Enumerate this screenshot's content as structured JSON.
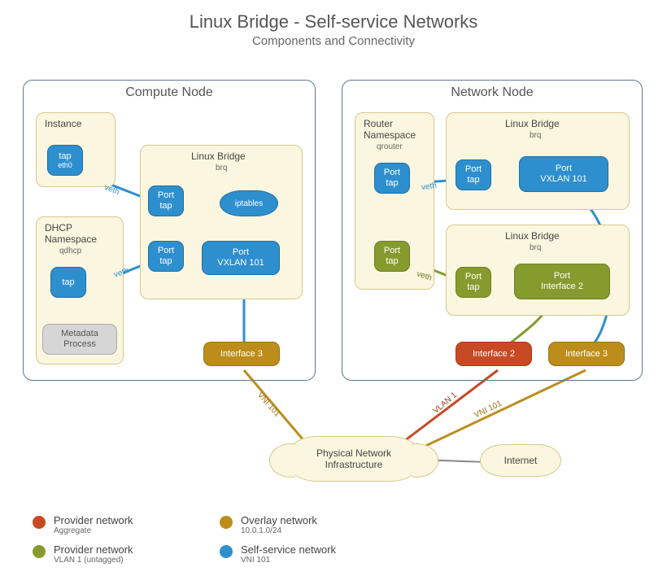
{
  "title": "Linux Bridge - Self-service Networks",
  "subtitle": "Components and Connectivity",
  "compute": {
    "title": "Compute Node",
    "instance": {
      "label": "Instance",
      "tap": "tap",
      "tap_sub": "eth0"
    },
    "dhcp": {
      "label": "DHCP",
      "label2": "Namespace",
      "sub": "qdhcp",
      "tap": "tap",
      "meta": "Metadata\nProcess"
    },
    "bridge": {
      "label": "Linux Bridge",
      "sub": "brq",
      "port_tap1": "Port\ntap",
      "port_tap2": "Port\ntap",
      "vxlan": "Port\nVXLAN 101",
      "iptables": "iptables"
    },
    "iface3": "Interface 3",
    "veth1": "veth",
    "veth2": "veth"
  },
  "network": {
    "title": "Network Node",
    "router": {
      "label": "Router",
      "label2": "Namespace",
      "sub": "qrouter",
      "port_tap": "Port\ntap",
      "port_tap2": "Port\ntap"
    },
    "bridge1": {
      "label": "Linux Bridge",
      "sub": "brq",
      "port_tap": "Port\ntap",
      "vxlan": "Port\nVXLAN 101"
    },
    "bridge2": {
      "label": "Linux Bridge",
      "sub": "brq",
      "port_tap": "Port\ntap",
      "port_iface2": "Port\nInterface 2"
    },
    "iface2": "Interface 2",
    "iface3": "Interface 3",
    "veth1": "veth",
    "veth2": "veth"
  },
  "infra": "Physical Network\nInfrastructure",
  "internet": "Internet",
  "links": {
    "vni101_l": "VNI 101",
    "vlan1": "VLAN 1",
    "vni101_r": "VNI 101"
  },
  "legend": {
    "provider_agg": {
      "t1": "Provider network",
      "t2": "Aggregate",
      "color": "#c74a24"
    },
    "provider_vlan": {
      "t1": "Provider network",
      "t2": "VLAN 1 (untagged)",
      "color": "#869b2d"
    },
    "overlay": {
      "t1": "Overlay network",
      "t2": "10.0.1.0/24",
      "color": "#bd8d1b"
    },
    "selfservice": {
      "t1": "Self-service network",
      "t2": "VNI 101",
      "color": "#2e8fcf"
    }
  }
}
